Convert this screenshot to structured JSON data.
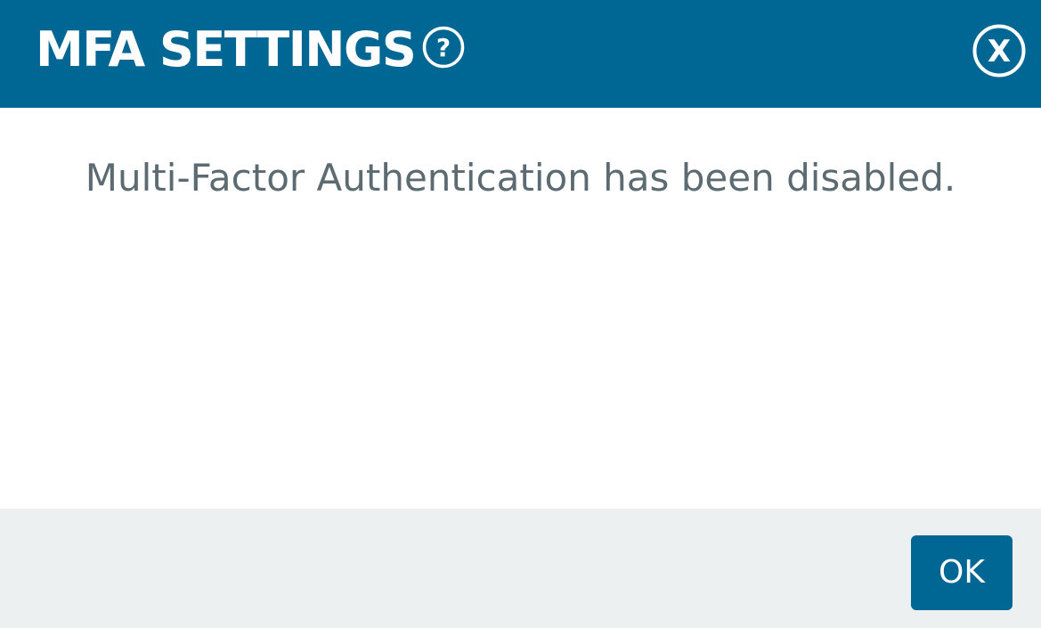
{
  "dialog": {
    "title": "MFA SETTINGS",
    "message": "Multi-Factor Authentication has been disabled.",
    "ok_label": "OK"
  },
  "icons": {
    "help": "question-circle-icon",
    "close": "close-circle-icon"
  },
  "colors": {
    "header_bg": "#006693",
    "button_bg": "#006693",
    "footer_bg": "#ecf0f1",
    "message_text": "#5b6b71",
    "header_text": "#ffffff"
  }
}
